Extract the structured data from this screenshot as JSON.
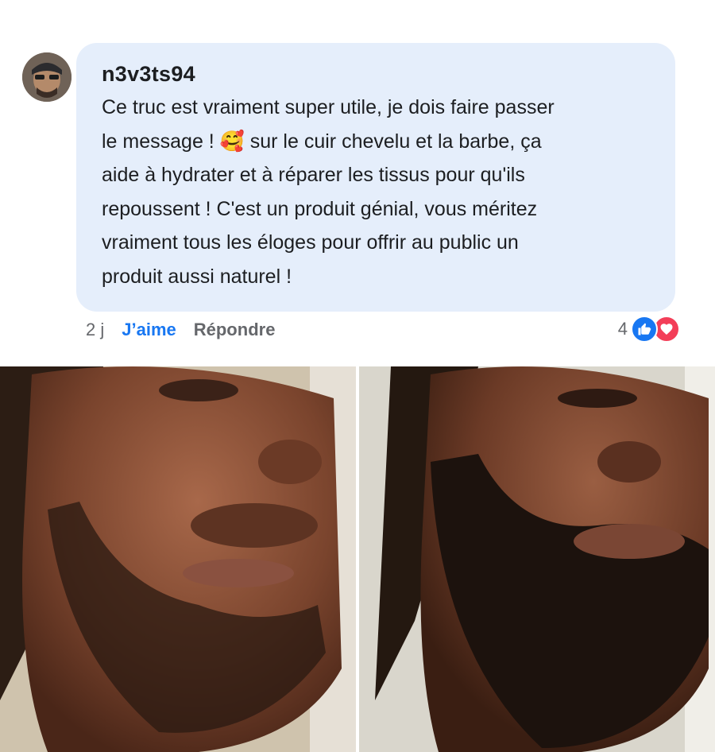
{
  "comment": {
    "author": "n3v3ts94",
    "text": "Ce truc est vraiment super utile, je dois faire passer\nle message ! 🥰 sur le cuir chevelu et la barbe, ça\naide à hydrater et à réparer les tissus pour qu'ils\nrepoussent ! C'est un produit génial, vous méritez\nvraiment tous les éloges pour offrir au public un\nproduit aussi naturel !",
    "time": "2 j",
    "like_label": "J’aime",
    "reply_label": "Répondre",
    "reaction_count": "4",
    "reactions": [
      "like-icon",
      "love-icon"
    ]
  },
  "colors": {
    "bubble": "#e5eefb",
    "like": "#1877f2",
    "love": "#f33e58",
    "muted": "#65676b"
  },
  "photos": [
    {
      "name": "before-photo"
    },
    {
      "name": "after-photo"
    }
  ]
}
